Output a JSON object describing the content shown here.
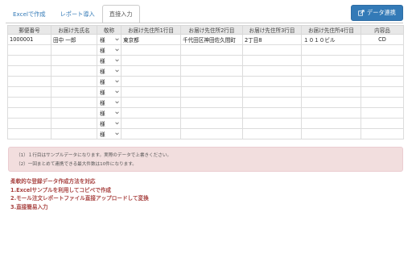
{
  "tabs": [
    {
      "label": "Excelで作成",
      "active": false
    },
    {
      "label": "レポート導入",
      "active": false
    },
    {
      "label": "直接入力",
      "active": true
    }
  ],
  "toolbar": {
    "connect_label": "データ連携",
    "connect_icon": "export-icon",
    "accent": "#337ab7"
  },
  "table": {
    "columns": [
      "郵便番号",
      "お届け先氏名",
      "敬称",
      "お届け先住所1行目",
      "お届け先住所2行目",
      "お届け先住所3行目",
      "お届け先住所4行目",
      "内容品"
    ],
    "rows": [
      [
        "1000001",
        "田中 一郎",
        "様",
        "東京都",
        "千代田区神田佐久間町",
        "2丁目8",
        "１０１０ビル",
        "CD"
      ],
      [
        "",
        "",
        "様",
        "",
        "",
        "",
        "",
        ""
      ],
      [
        "",
        "",
        "様",
        "",
        "",
        "",
        "",
        ""
      ],
      [
        "",
        "",
        "様",
        "",
        "",
        "",
        "",
        ""
      ],
      [
        "",
        "",
        "様",
        "",
        "",
        "",
        "",
        ""
      ],
      [
        "",
        "",
        "様",
        "",
        "",
        "",
        "",
        ""
      ],
      [
        "",
        "",
        "様",
        "",
        "",
        "",
        "",
        ""
      ],
      [
        "",
        "",
        "様",
        "",
        "",
        "",
        "",
        ""
      ],
      [
        "",
        "",
        "様",
        "",
        "",
        "",
        "",
        ""
      ],
      [
        "",
        "",
        "様",
        "",
        "",
        "",
        "",
        ""
      ]
    ]
  },
  "notes": [
    "（1）１行目はサンプルデータになります。実際のデータで上書きください。",
    "（2）一回まとめて連携できる最大件数は10件になります。"
  ],
  "info": {
    "title": "柔軟的な登録データ作成方法を対応",
    "items": [
      "1.Excelサンプルを利用してコピペで作成",
      "2.モール注文レポートファイル直接アップロードして変換",
      "3.直接簡易入力"
    ],
    "color": "#a94442"
  }
}
